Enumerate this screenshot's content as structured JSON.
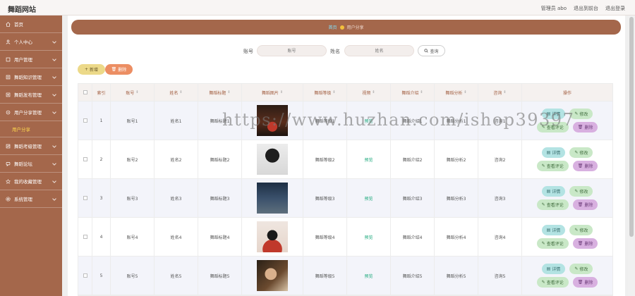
{
  "brand": "舞蹈网站",
  "top_links": {
    "admin": "管理员 abo",
    "front": "退出到前台",
    "logout": "退出登录"
  },
  "sidebar": {
    "items": [
      {
        "label": "首页",
        "icon": "home-icon"
      },
      {
        "label": "个人中心",
        "icon": "user-icon"
      },
      {
        "label": "用户管理",
        "icon": "users-icon"
      },
      {
        "label": "舞蹈知识管理",
        "icon": "book-icon"
      },
      {
        "label": "舞蹈发布管理",
        "icon": "publish-icon"
      },
      {
        "label": "用户分享管理",
        "icon": "share-icon"
      },
      {
        "label": "舞蹈考级管理",
        "icon": "grade-icon"
      },
      {
        "label": "舞蹈论坛",
        "icon": "forum-icon"
      },
      {
        "label": "我的收藏管理",
        "icon": "star-icon"
      },
      {
        "label": "系统管理",
        "icon": "settings-icon"
      }
    ],
    "active_sub": "用户分享"
  },
  "breadcrumb": {
    "home": "首页",
    "current": "用户分享"
  },
  "search": {
    "account_label": "账号",
    "account_placeholder": "账号",
    "name_label": "姓名",
    "name_placeholder": "姓名",
    "query_button": "查询"
  },
  "actions": {
    "add": "新增",
    "delete": "删除"
  },
  "table": {
    "headers": [
      "索引",
      "账号",
      "姓名",
      "舞蹈标题",
      "舞蹈图片",
      "舞蹈等级",
      "视频",
      "舞蹈介绍",
      "舞蹈分析",
      "咨询",
      "操作"
    ],
    "rows": [
      {
        "index": "1",
        "account": "账号1",
        "name": "姓名1",
        "title": "舞蹈标题1",
        "level": "舞蹈等级1",
        "video": "预览",
        "intro": "舞蹈介绍1",
        "analysis": "舞蹈分析1",
        "consult": "咨询1"
      },
      {
        "index": "2",
        "account": "账号2",
        "name": "姓名2",
        "title": "舞蹈标题2",
        "level": "舞蹈等级2",
        "video": "预览",
        "intro": "舞蹈介绍2",
        "analysis": "舞蹈分析2",
        "consult": "咨询2"
      },
      {
        "index": "3",
        "account": "账号3",
        "name": "姓名3",
        "title": "舞蹈标题3",
        "level": "舞蹈等级3",
        "video": "预览",
        "intro": "舞蹈介绍3",
        "analysis": "舞蹈分析3",
        "consult": "咨询3"
      },
      {
        "index": "4",
        "account": "账号4",
        "name": "姓名4",
        "title": "舞蹈标题4",
        "level": "舞蹈等级4",
        "video": "预览",
        "intro": "舞蹈介绍4",
        "analysis": "舞蹈分析4",
        "consult": "咨询4"
      },
      {
        "index": "5",
        "account": "账号5",
        "name": "姓名5",
        "title": "舞蹈标题5",
        "level": "舞蹈等级5",
        "video": "预览",
        "intro": "舞蹈介绍5",
        "analysis": "舞蹈分析5",
        "consult": "咨询5"
      }
    ],
    "ops": {
      "detail": "详情",
      "edit": "修改",
      "review": "查看评论",
      "delete": "删除"
    }
  },
  "watermark": "https://www.huzhan.com/ishop39397",
  "colors": {
    "sidebar": "#a4674b",
    "accent_text": "#a15d3f",
    "active_sub": "#ffd94d"
  }
}
